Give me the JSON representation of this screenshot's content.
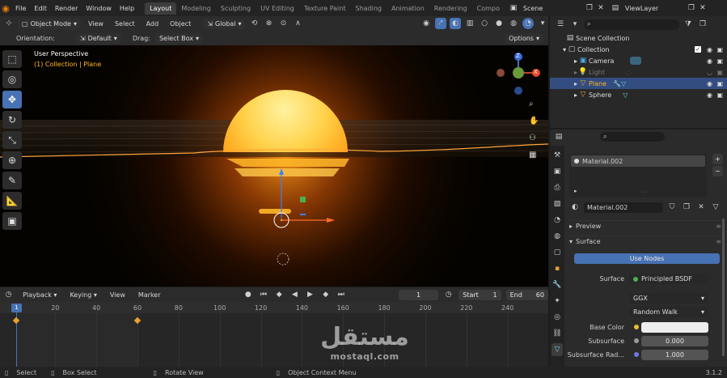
{
  "menu": [
    "File",
    "Edit",
    "Render",
    "Window",
    "Help"
  ],
  "workspaces": [
    "Layout",
    "Modeling",
    "Sculpting",
    "UV Editing",
    "Texture Paint",
    "Shading",
    "Animation",
    "Rendering",
    "Compo"
  ],
  "active_workspace": "Layout",
  "scene_name": "Scene",
  "view_layer": "ViewLayer",
  "viewport": {
    "mode": "Object Mode",
    "menus": [
      "View",
      "Select",
      "Add",
      "Object"
    ],
    "transform_orientation": "Global",
    "orientation_label": "Orientation:",
    "orientation_value": "Default",
    "drag_label": "Drag:",
    "drag_value": "Select Box",
    "options_label": "Options",
    "overlay_title": "User Perspective",
    "overlay_subtitle": "(1) Collection | Plane",
    "gizmo": {
      "z": "Z",
      "x": "X"
    }
  },
  "timeline": {
    "menus": [
      "Playback",
      "Keying",
      "View",
      "Marker"
    ],
    "current_frame": "1",
    "start_label": "Start",
    "start": "1",
    "end_label": "End",
    "end": "60",
    "ticks": [
      "20",
      "40",
      "60",
      "80",
      "100",
      "120",
      "140",
      "160",
      "180",
      "200",
      "220",
      "240"
    ],
    "current_marker": "1"
  },
  "status": {
    "items": [
      "Select",
      "Box Select",
      "Rotate View",
      "Object Context Menu"
    ],
    "version": "3.1.2"
  },
  "outliner": {
    "root": "Scene Collection",
    "collection": "Collection",
    "items": [
      {
        "name": "Camera",
        "dim": false,
        "selected": false
      },
      {
        "name": "Light",
        "dim": true,
        "selected": false
      },
      {
        "name": "Plane",
        "dim": false,
        "selected": true
      },
      {
        "name": "Sphere",
        "dim": false,
        "selected": false
      }
    ]
  },
  "properties": {
    "material_slot": "Material.002",
    "material_name": "Material.002",
    "preview_label": "Preview",
    "surface_label": "Surface",
    "use_nodes": "Use Nodes",
    "surface_field_label": "Surface",
    "surface_shader": "Principled BSDF",
    "distribution": "GGX",
    "subsurface_method": "Random Walk",
    "rows": [
      {
        "label": "Base Color",
        "value": "",
        "color": "#eeeeee"
      },
      {
        "label": "Subsurface",
        "value": "0.000",
        "color": ""
      },
      {
        "label": "Subsurface Rad...",
        "value": "1.000",
        "color": ""
      }
    ]
  },
  "watermark": {
    "arabic": "مستقل",
    "latin": "mostaql.com"
  },
  "colors": {
    "accent": "#4772b3",
    "sun": "#ffb629",
    "selected_row": "#334d80"
  }
}
